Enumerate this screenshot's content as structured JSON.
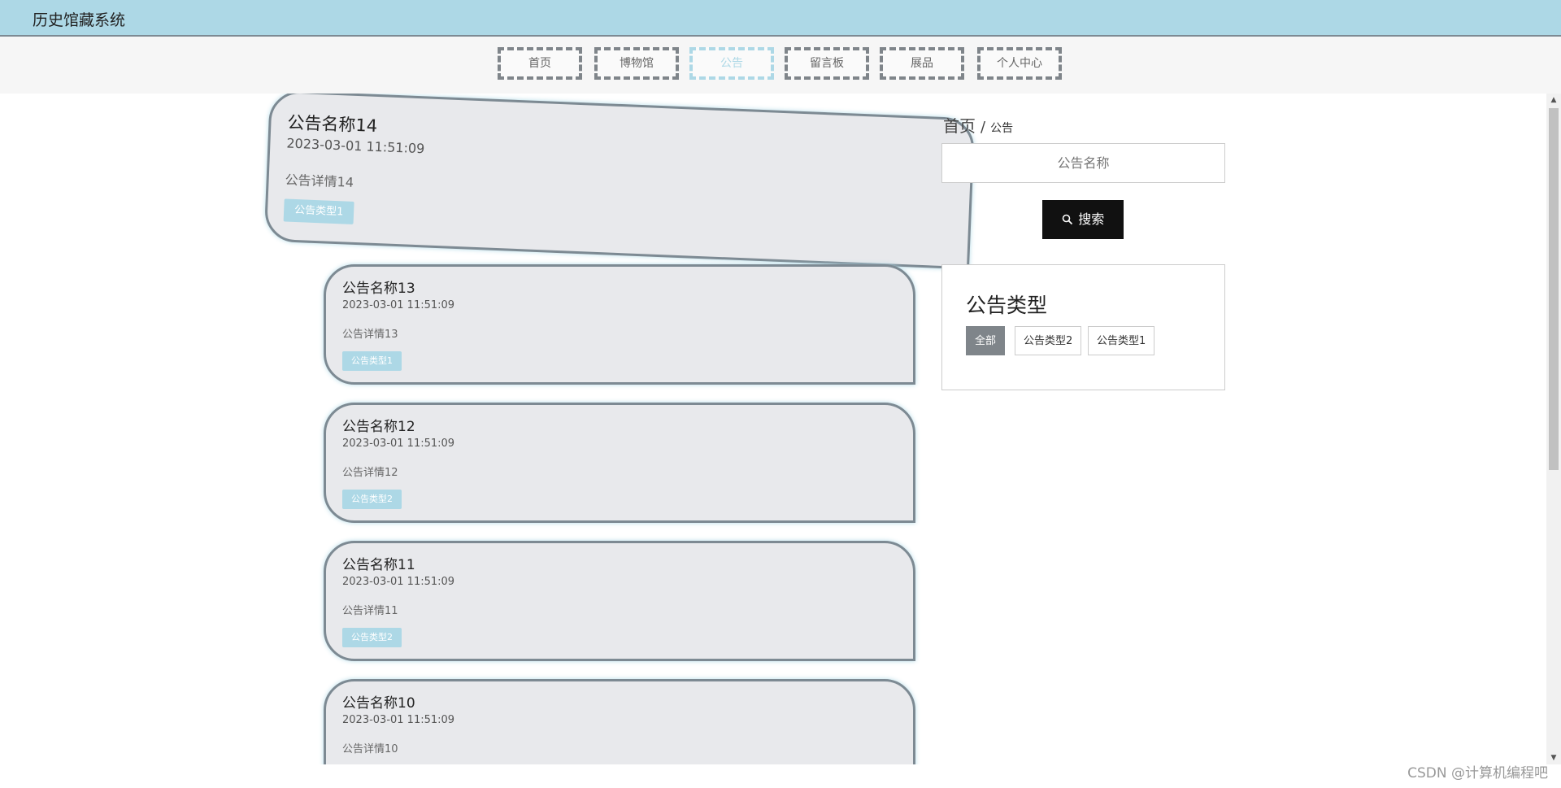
{
  "header": {
    "site_title": "历史馆藏系统"
  },
  "nav": {
    "items": [
      {
        "label": "首页"
      },
      {
        "label": "博物馆"
      },
      {
        "label": "公告"
      },
      {
        "label": "留言板"
      },
      {
        "label": "展品"
      },
      {
        "label": "个人中心"
      }
    ],
    "active": "公告"
  },
  "notices": [
    {
      "title": "公告名称14",
      "time": "2023-03-01 11:51:09",
      "detail": "公告详情14",
      "type": "公告类型1"
    },
    {
      "title": "公告名称13",
      "time": "2023-03-01 11:51:09",
      "detail": "公告详情13",
      "type": "公告类型1"
    },
    {
      "title": "公告名称12",
      "time": "2023-03-01 11:51:09",
      "detail": "公告详情12",
      "type": "公告类型2"
    },
    {
      "title": "公告名称11",
      "time": "2023-03-01 11:51:09",
      "detail": "公告详情11",
      "type": "公告类型2"
    },
    {
      "title": "公告名称10",
      "time": "2023-03-01 11:51:09",
      "detail": "公告详情10",
      "type": ""
    }
  ],
  "breadcrumb": {
    "home": "首页",
    "separator": "/",
    "current": "公告"
  },
  "search": {
    "placeholder": "公告名称",
    "button_label": "搜索",
    "button_icon": "search-icon"
  },
  "type_filter": {
    "title": "公告类型",
    "options": [
      {
        "label": "全部",
        "active": true
      },
      {
        "label": "公告类型2",
        "active": false
      },
      {
        "label": "公告类型1",
        "active": false
      }
    ]
  },
  "watermark": "CSDN @计算机编程吧",
  "colors": {
    "header_bg": "#add8e6",
    "accent": "#add8e6",
    "card_bg": "#e8e9ec",
    "card_border": "#7d8a93",
    "button_dark": "#111111",
    "active_filter": "#7f858a"
  }
}
